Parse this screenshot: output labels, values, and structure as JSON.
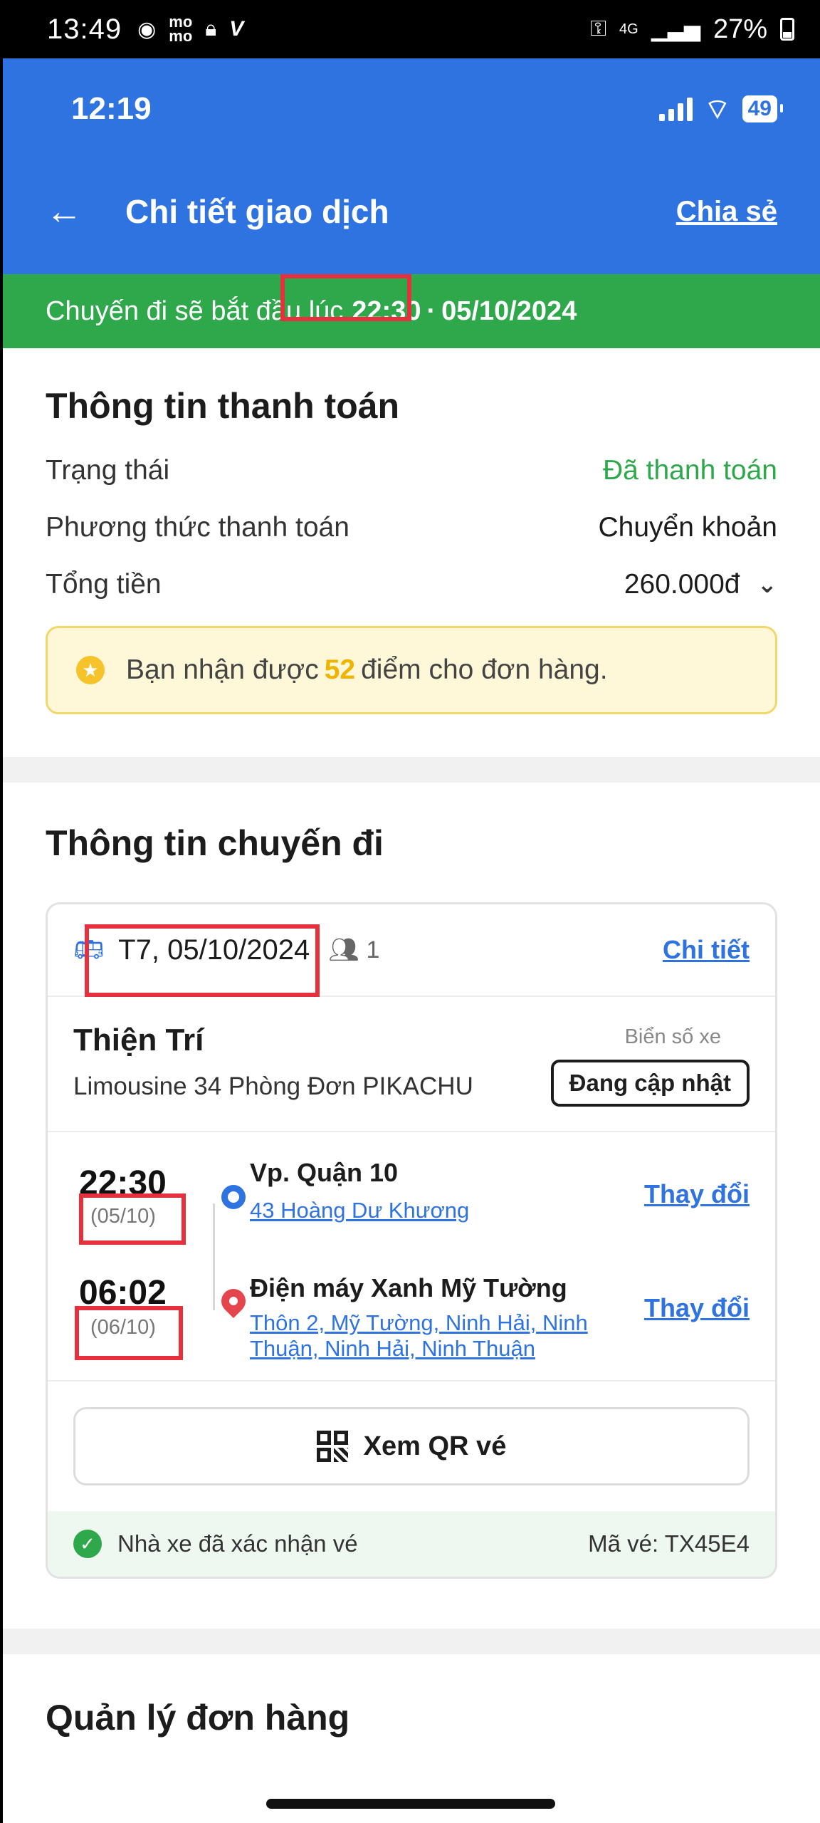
{
  "device_status": {
    "time": "13:49",
    "notif_icons": [
      "messenger-icon",
      "momo-icon",
      "lock-icon",
      "v-icon"
    ],
    "network": "4G",
    "battery": "27%"
  },
  "app_status": {
    "time": "12:19",
    "battery": "49"
  },
  "header": {
    "back_icon": "←",
    "title": "Chi tiết giao dịch",
    "share_label": "Chia sẻ"
  },
  "banner": {
    "prefix": "Chuyến đi sẽ bắt đầu lúc",
    "time": "22:30",
    "separator": "·",
    "date": "05/10/2024"
  },
  "payment": {
    "title": "Thông tin thanh toán",
    "rows": [
      {
        "label": "Trạng thái",
        "value": "Đã thanh toán"
      },
      {
        "label": "Phương thức thanh toán",
        "value": "Chuyển khoản"
      },
      {
        "label": "Tổng tiền",
        "value": "260.000đ"
      }
    ],
    "points_before": "Bạn nhận được",
    "points_value": "52",
    "points_after": "điểm cho đơn hàng."
  },
  "trip": {
    "title": "Thông tin chuyến đi",
    "date": "T7, 05/10/2024",
    "passengers": "1",
    "detail_link": "Chi tiết",
    "operator_name": "Thiện Trí",
    "vehicle": "Limousine 34 Phòng Đơn PIKACHU",
    "plate_label": "Biển số xe",
    "plate_value": "Đang cập nhật",
    "departure": {
      "time": "22:30",
      "date": "(05/10)",
      "name": "Vp. Quận 10",
      "address": "43 Hoàng Dư Khương",
      "change": "Thay đổi"
    },
    "arrival": {
      "time": "06:02",
      "date": "(06/10)",
      "name": "Điện máy Xanh Mỹ Tường",
      "address": "Thôn 2, Mỹ Tường, Ninh Hải, Ninh Thuận, Ninh Hải, Ninh Thuận",
      "change": "Thay đổi"
    },
    "qr_label": "Xem QR vé",
    "confirm_text": "Nhà xe đã xác nhận vé",
    "ticket_code": "Mã vé: TX45E4"
  },
  "manage": {
    "title": "Quản lý đơn hàng"
  },
  "colors": {
    "primary": "#2f73e0",
    "success": "#2ea84a",
    "highlight": "#e5303d",
    "points": "#f0b400"
  }
}
